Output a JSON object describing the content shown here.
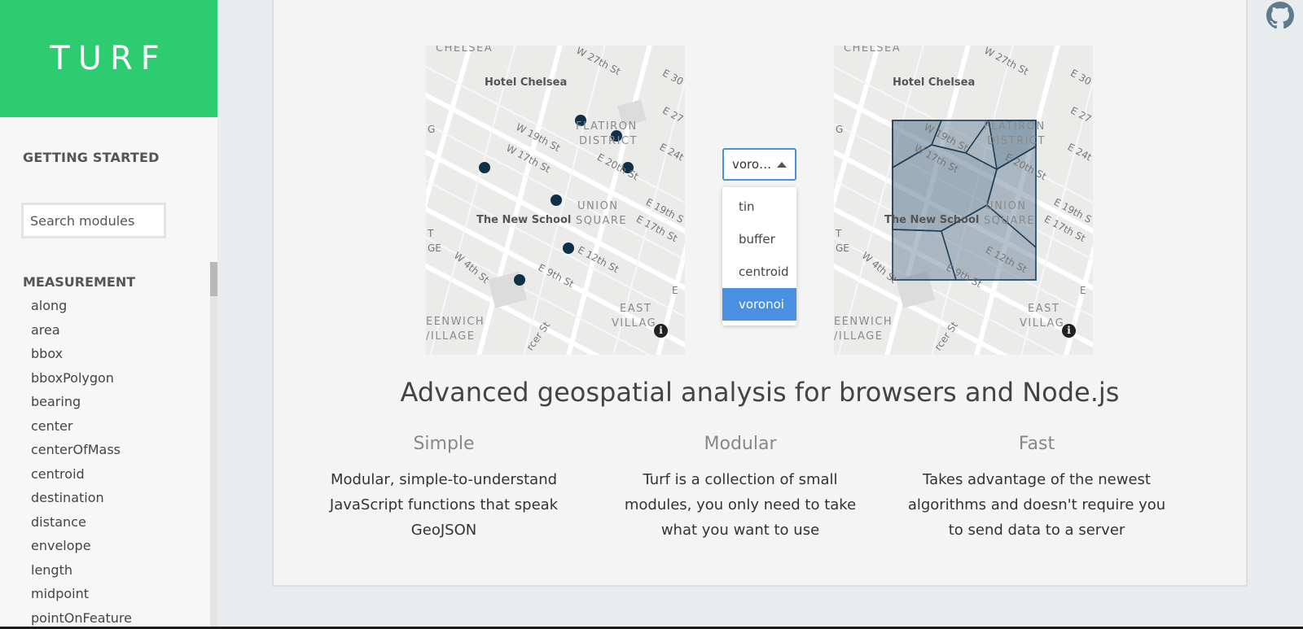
{
  "sidebar": {
    "brand": "TURF",
    "getting_started": "GETTING STARTED",
    "search": {
      "placeholder": "Search modules",
      "value": ""
    },
    "section_title": "MEASUREMENT",
    "modules": [
      "along",
      "area",
      "bbox",
      "bboxPolygon",
      "bearing",
      "center",
      "centerOfMass",
      "centroid",
      "destination",
      "distance",
      "envelope",
      "length",
      "midpoint",
      "pointOnFeature"
    ]
  },
  "demo": {
    "map_labels": {
      "chelsea": "CHELSEA",
      "hotel_chelsea": "Hotel Chelsea",
      "w27": "W 27th St",
      "e30": "E 30",
      "e27": "E 27",
      "flatiron": "FLATIRON",
      "district": "DISTRICT",
      "w19": "W 19th St",
      "w17": "W 17th St",
      "e24": "E 24t",
      "e20": "E 20th St",
      "g": "G",
      "union": "UNION",
      "square": "SQUARE",
      "e19": "E 19th S",
      "e17": "E 17th St",
      "new_school": "The New School",
      "t": "T",
      "ge": "GE",
      "e12": "E 12th St",
      "w4": "W 4th St",
      "e9": "E 9th St",
      "e": "E",
      "east": "EAST",
      "village": "VILLAG",
      "greenwich": "EENWICH",
      "village2": "/ILLAGE",
      "mercer": "rcer St"
    },
    "info_icon": "i",
    "select": {
      "value": "voro…",
      "options": [
        "tin",
        "buffer",
        "centroid",
        "voronoi"
      ],
      "selected": "voronoi"
    },
    "colors": {
      "point": "#0e3148",
      "polygon_fill": "#5a7891",
      "polygon_stroke": "#1f3d56",
      "accent": "#4a90e2",
      "brand": "#2ecc71"
    }
  },
  "headline": "Advanced geospatial analysis for browsers and Node.js",
  "features": [
    {
      "title": "Simple",
      "lines": [
        "Modular, simple-to-understand",
        "JavaScript functions that speak",
        "GeoJSON"
      ]
    },
    {
      "title": "Modular",
      "lines": [
        "Turf is a collection of small",
        "modules, you only need to take",
        "what you want to use"
      ]
    },
    {
      "title": "Fast",
      "lines": [
        "Takes advantage of the newest",
        "algorithms and doesn't require you",
        "to send data to a server"
      ]
    }
  ],
  "github_icon": "github-icon"
}
